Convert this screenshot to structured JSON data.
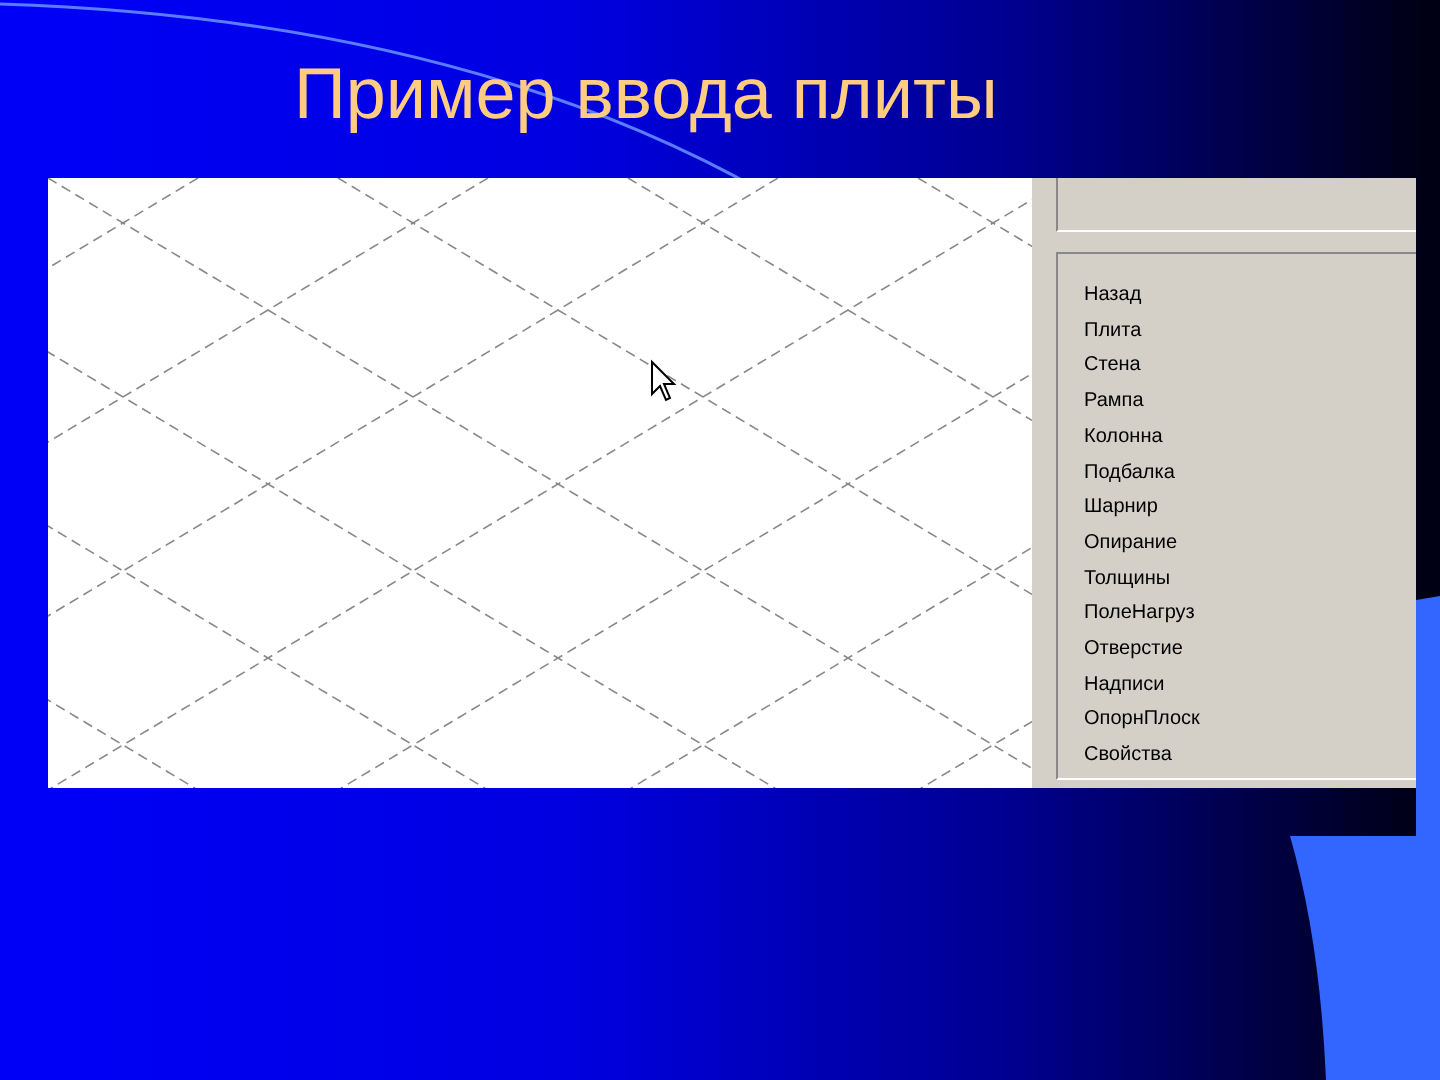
{
  "slide": {
    "title": "Пример ввода плиты"
  },
  "menu": {
    "items": [
      "Назад",
      "Плита",
      "Стена",
      "Рампа",
      "Колонна",
      "Подбалка",
      "Шарнир",
      "Опирание",
      "Толщины",
      "ПолеНагруз",
      "Отверстие",
      "Надписи",
      "ОпорнПлоск",
      "Свойства"
    ]
  }
}
